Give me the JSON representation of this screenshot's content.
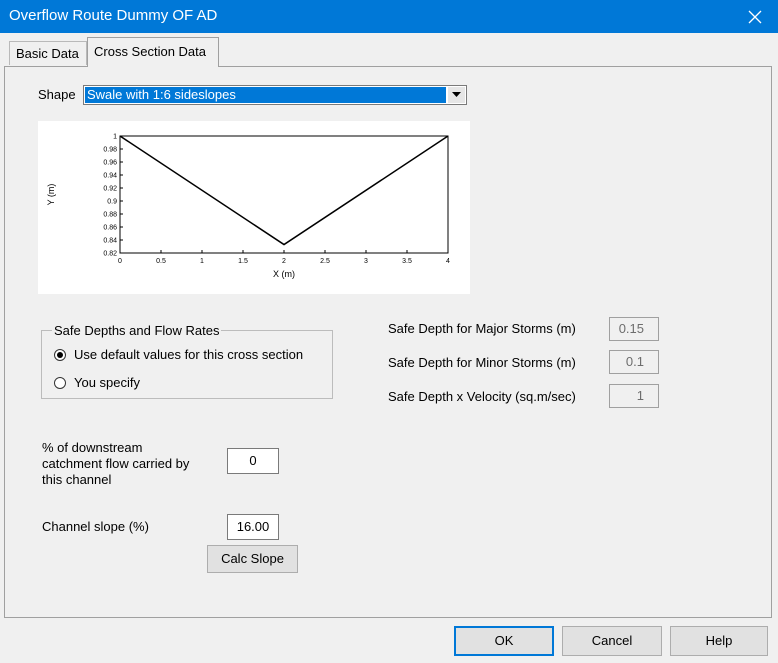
{
  "window": {
    "title": "Overflow Route Dummy OF AD",
    "close_icon": "close-icon"
  },
  "tabs": [
    {
      "label": "Basic Data",
      "active": false
    },
    {
      "label": "Cross Section Data",
      "active": true
    }
  ],
  "shape": {
    "label": "Shape",
    "selected": "Swale with 1:6 sideslopes"
  },
  "chart_data": {
    "type": "line",
    "x": [
      0,
      2,
      4
    ],
    "y": [
      1,
      0.833,
      1
    ],
    "xlabel": "X (m)",
    "ylabel": "Y (m)",
    "xlim": [
      0,
      4
    ],
    "ylim": [
      0.82,
      1
    ],
    "xticks": [
      "0",
      "0.5",
      "1",
      "1.5",
      "2",
      "2.5",
      "3",
      "3.5",
      "4"
    ],
    "yticks": [
      "0.82",
      "0.84",
      "0.86",
      "0.88",
      "0.9",
      "0.92",
      "0.94",
      "0.96",
      "0.98",
      "1"
    ],
    "grid": false,
    "line_color": "#000000"
  },
  "safe_depths": {
    "group_title": "Safe Depths and Flow Rates",
    "options": [
      {
        "label": "Use default values for this cross section",
        "selected": true
      },
      {
        "label": "You specify",
        "selected": false
      }
    ],
    "fields": [
      {
        "label": "Safe Depth for Major Storms (m)",
        "value": "0.15"
      },
      {
        "label": "Safe Depth for Minor Storms (m)",
        "value": "0.1"
      },
      {
        "label": "Safe Depth x Velocity (sq.m/sec)",
        "value": "1"
      }
    ]
  },
  "downstream": {
    "label_lines": [
      "% of downstream",
      "catchment flow carried by",
      "this channel"
    ],
    "value": "0"
  },
  "slope": {
    "label": "Channel slope (%)",
    "value": "16.00",
    "calc_button": "Calc Slope"
  },
  "footer": {
    "ok": "OK",
    "cancel": "Cancel",
    "help": "Help"
  },
  "colors": {
    "titlebar": "#0078d7",
    "selection": "#0078d7",
    "dialog_bg": "#f0f0f0"
  }
}
